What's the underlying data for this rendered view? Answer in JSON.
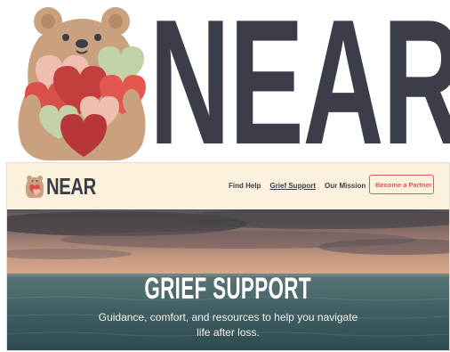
{
  "brand": {
    "wordmark": "NEAR"
  },
  "nav": {
    "logo_text": "NEAR",
    "links": [
      {
        "label": "Find Help",
        "active": false
      },
      {
        "label": "Grief Support",
        "active": true
      },
      {
        "label": "Our Mission",
        "active": false
      }
    ],
    "cta_label": "Become a Partner"
  },
  "hero": {
    "title": "GRIEF SUPPORT",
    "subtitle": "Guidance, comfort, and resources to help you navigate life after loss."
  },
  "icons": {
    "mascot": "bear-holding-hearts-icon"
  },
  "colors": {
    "ink": "#3b3d48",
    "cream": "#fbf1dd",
    "accent": "#e4574f",
    "bear": "#c9a17f",
    "heart_red": "#d94f4a",
    "heart_pink": "#eebfb0",
    "heart_green": "#c3d1a7",
    "sea": "#3f5e63"
  }
}
